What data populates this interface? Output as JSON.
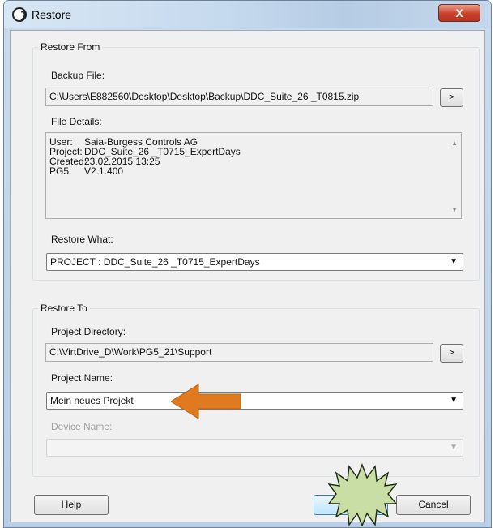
{
  "window": {
    "title": "Restore",
    "close_label": "X"
  },
  "restore_from": {
    "legend": "Restore From",
    "backup_file_label": "Backup File:",
    "backup_file_value": "C:\\Users\\E882560\\Desktop\\Desktop\\Backup\\DDC_Suite_26 _T0815.zip",
    "browse_label": ">",
    "file_details_label": "File Details:",
    "file_details": [
      {
        "key": "User:",
        "value": "Saia-Burgess Controls AG"
      },
      {
        "key": "Project:",
        "value": "DDC_Suite_26 _T0715_ExpertDays"
      },
      {
        "key": "Created:",
        "value": "23.02.2015 13:25"
      },
      {
        "key": "PG5:",
        "value": "V2.1.400"
      }
    ],
    "restore_what_label": "Restore What:",
    "restore_what_value": "PROJECT : DDC_Suite_26 _T0715_ExpertDays"
  },
  "restore_to": {
    "legend": "Restore To",
    "project_directory_label": "Project Directory:",
    "project_directory_value": "C:\\VirtDrive_D\\Work\\PG5_21\\Support",
    "browse_label": ">",
    "project_name_label": "Project Name:",
    "project_name_value": "Mein neues Projekt",
    "device_name_label": "Device Name:",
    "device_name_value": ""
  },
  "buttons": {
    "help": "Help",
    "cancel": "Cancel"
  },
  "colors": {
    "arrow": "#e07a20",
    "starburst": "#c8dea4"
  }
}
